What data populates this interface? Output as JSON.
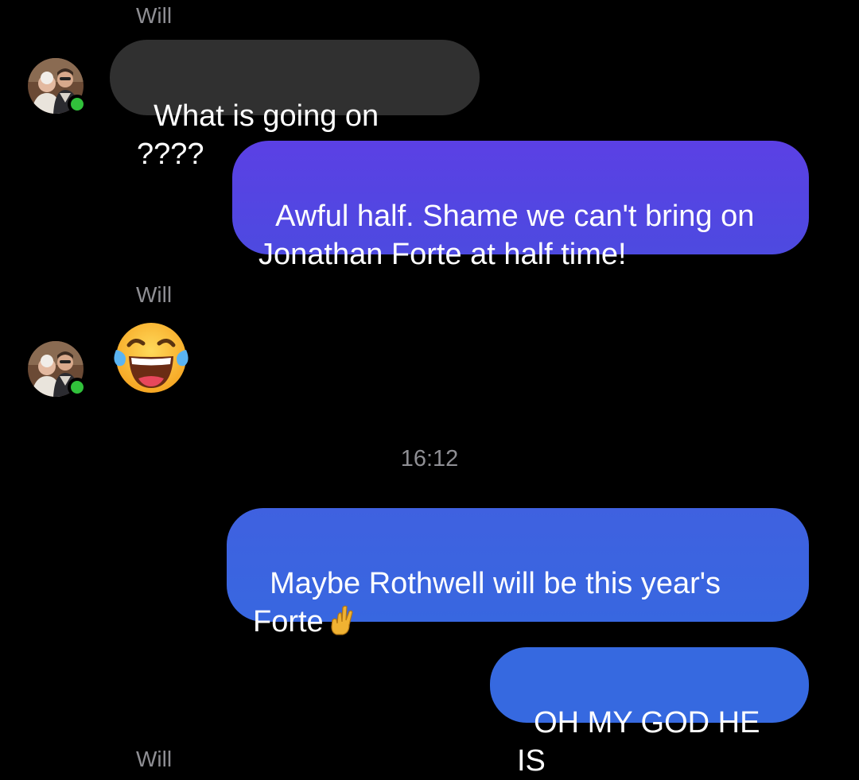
{
  "messages": [
    {
      "type": "sender_label",
      "text": "Will"
    },
    {
      "type": "incoming",
      "text": "What is going on ????"
    },
    {
      "type": "outgoing",
      "text": "Awful half. Shame we can't bring on Jonathan Forte at half time!"
    },
    {
      "type": "sender_label",
      "text": "Will"
    },
    {
      "type": "incoming_emoji",
      "emoji": "face-with-tears-of-joy"
    },
    {
      "type": "timestamp",
      "text": "16:12"
    },
    {
      "type": "outgoing",
      "text": "Maybe Rothwell will be this year's Forte",
      "trailing_emoji": "crossed-fingers"
    },
    {
      "type": "outgoing",
      "text": "OH MY GOD HE IS"
    },
    {
      "type": "sender_label",
      "text": "Will"
    }
  ],
  "colors": {
    "background": "#000000",
    "incoming_bubble": "#303030",
    "outgoing_gradient_top": "#5b40e4",
    "outgoing_gradient_bottom": "#3669e0",
    "presence_online": "#31c13b",
    "secondary_text": "#8e8e93"
  }
}
